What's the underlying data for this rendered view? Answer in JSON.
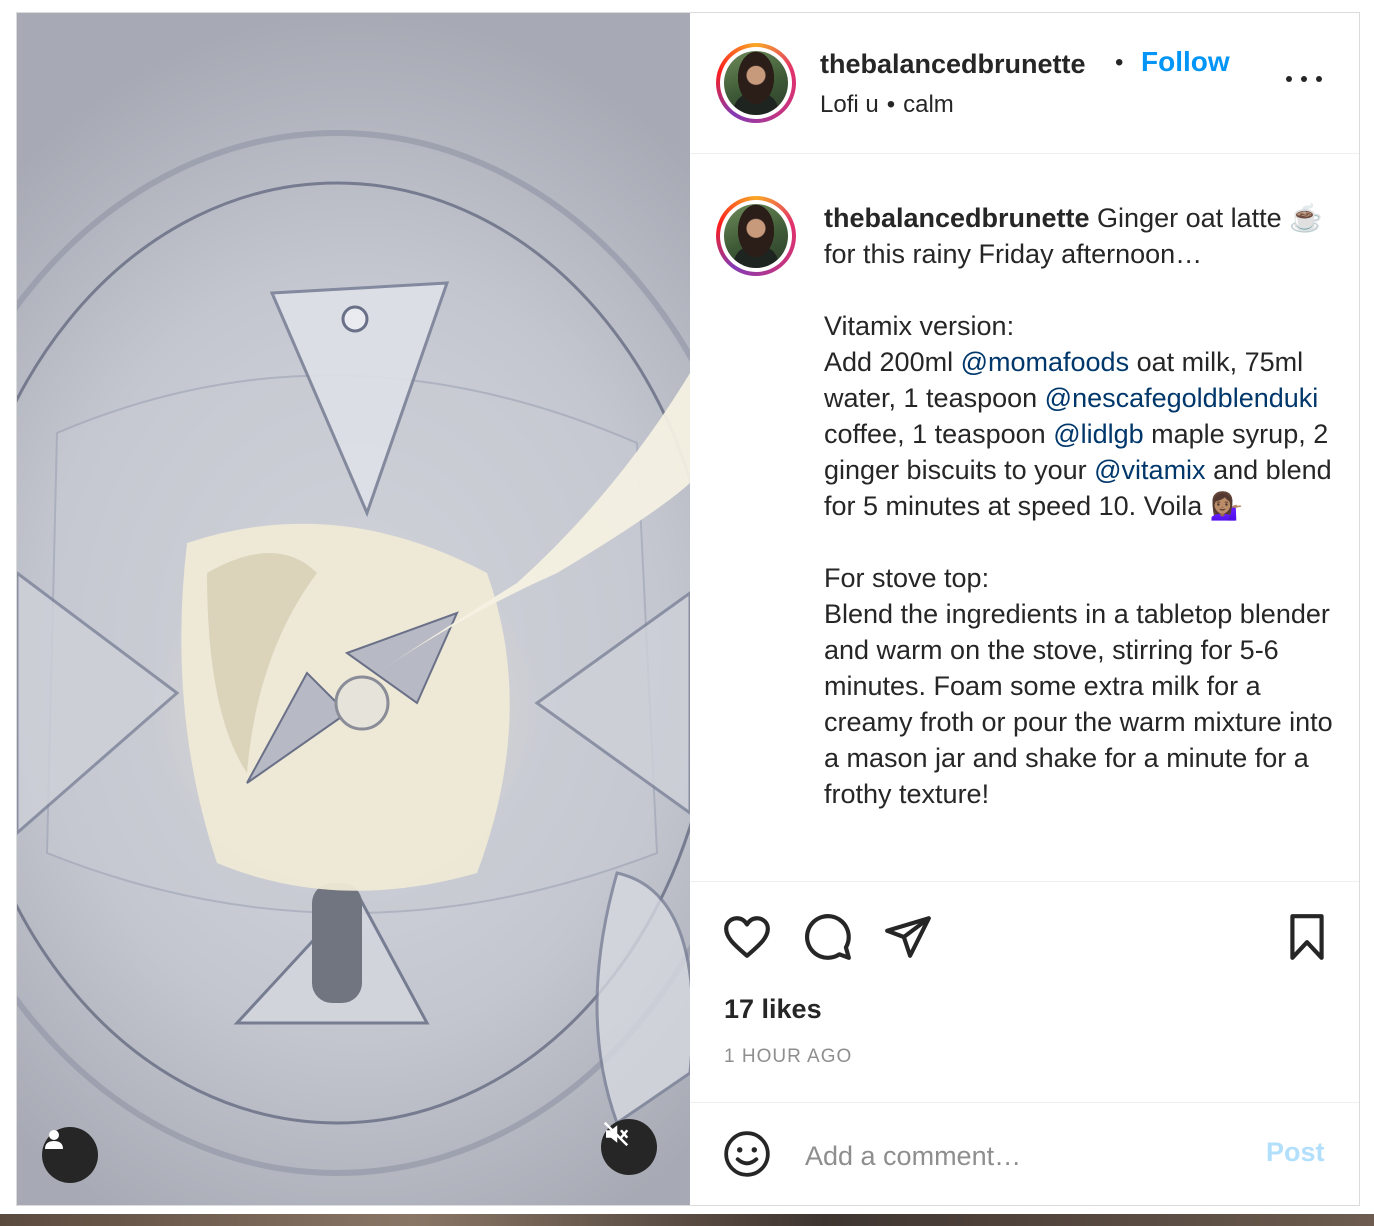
{
  "post": {
    "username": "thebalancedbrunette",
    "follow_label": "Follow",
    "audio": {
      "artist": "Lofi u",
      "track": "calm"
    },
    "more_icon": "more-horizontal-icon"
  },
  "caption": {
    "username": "thebalancedbrunette",
    "intro": " Ginger oat latte ☕️ for this rainy Friday afternoon…",
    "vitamix_heading": "Vitamix version:",
    "vitamix_1": "Add 200ml ",
    "mention_1": "@momafoods",
    "vitamix_2": " oat milk, 75ml water, 1 teaspoon ",
    "mention_2": "@nescafegoldblenduki",
    "vitamix_3": " coffee, 1 teaspoon ",
    "mention_3": "@lidlgb",
    "vitamix_4": " maple syrup, 2 ginger biscuits to your ",
    "mention_4": "@vitamix",
    "vitamix_5": " and blend for 5 minutes at speed 10. Voila 💁🏽‍♀️",
    "stove_heading": "For stove top:",
    "stove_text": "Blend the ingredients in a tabletop blender and warm on the stove, stirring for 5-6 minutes. Foam some extra milk for a creamy froth or pour the warm mixture into a mason jar and shake for a minute for a frothy texture!"
  },
  "actions": {
    "like_icon": "heart-icon",
    "comment_icon": "comment-icon",
    "share_icon": "share-icon",
    "save_icon": "bookmark-icon",
    "likes_text": "17 likes",
    "time_text": "1 HOUR AGO"
  },
  "comment": {
    "emoji_icon": "emoji-icon",
    "placeholder": "Add a comment…",
    "post_label": "Post"
  },
  "media": {
    "user_tag_icon": "user-icon",
    "mute_icon": "muted-speaker-icon"
  },
  "colors": {
    "accent": "#0095f6",
    "post_disabled": "#b2dffc",
    "mention": "#00376b",
    "meta_gray": "#8e8e8e"
  }
}
